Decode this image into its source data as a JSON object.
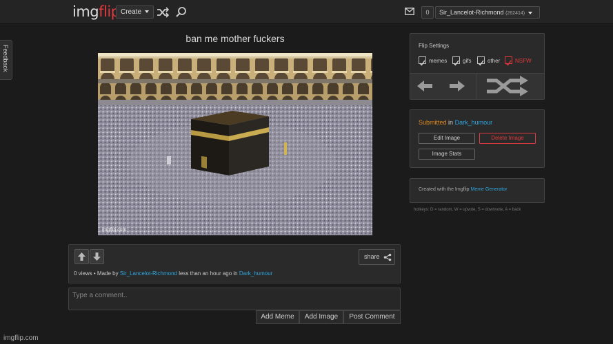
{
  "header": {
    "logo_part1": "img",
    "logo_part2": "flip",
    "create_label": "Create",
    "notification_count": "0",
    "username": "Sir_Lancelot-Richmond",
    "user_points": "(262414)"
  },
  "feedback_label": "Feedback",
  "post": {
    "title": "ban me mother fuckers",
    "watermark": "imgflip.com",
    "share_label": "share",
    "meta_prefix": "0 views • Made by",
    "author": "Sir_Lancelot-Richmond",
    "meta_time": "less than an hour ago in",
    "stream": "Dark_humour"
  },
  "comment": {
    "placeholder": "Type a comment..",
    "add_meme": "Add Meme",
    "add_image": "Add Image",
    "post_comment": "Post Comment"
  },
  "flip_settings": {
    "title": "Flip Settings",
    "options": [
      {
        "label": "memes",
        "checked": true
      },
      {
        "label": "gifs",
        "checked": true
      },
      {
        "label": "other",
        "checked": true
      },
      {
        "label": "NSFW",
        "checked": true
      }
    ]
  },
  "submitted": {
    "prefix": "Submitted",
    "in_word": "in",
    "stream": "Dark_humour",
    "edit_label": "Edit Image",
    "delete_label": "Delete Image",
    "stats_label": "Image Stats"
  },
  "generator": {
    "prefix": "Created with the Imgflip",
    "link": "Meme Generator"
  },
  "hotkeys": "hotkeys: D = random, W = upvote, S = downvote, A = back",
  "footer": "imgflip.com",
  "colors": {
    "accent_red": "#e0393e",
    "link_blue": "#2ea7e0",
    "submitted_orange": "#e08a1e",
    "background": "#1b1b1b"
  }
}
